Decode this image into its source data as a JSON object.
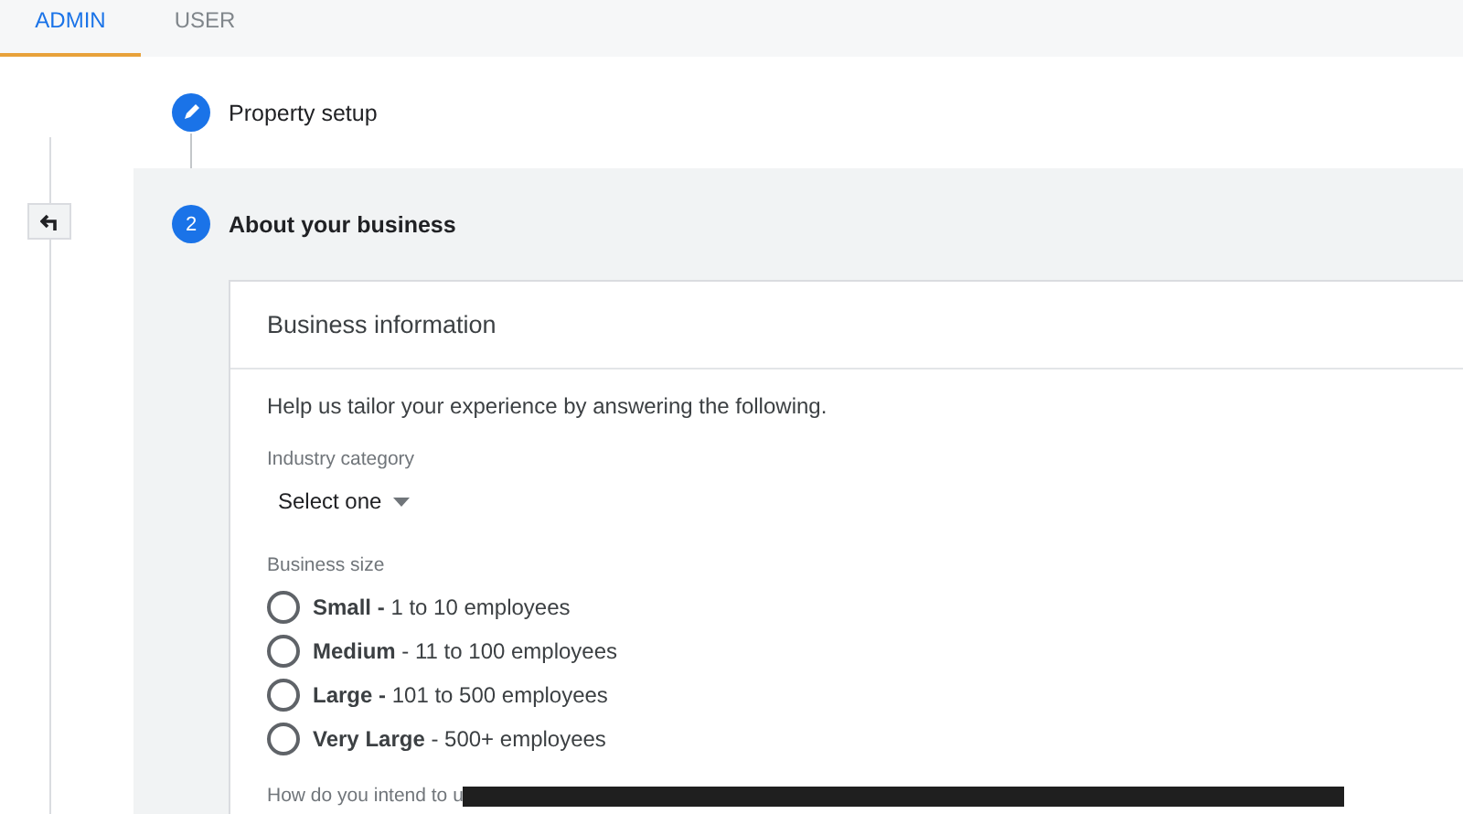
{
  "tabs": [
    {
      "label": "ADMIN",
      "selected": true
    },
    {
      "label": "USER",
      "selected": false
    }
  ],
  "steps": [
    {
      "kind": "done",
      "label": "Property setup",
      "active": false
    },
    {
      "kind": "number",
      "number": "2",
      "label": "About your business",
      "active": true
    }
  ],
  "card": {
    "title": "Business information",
    "intro": "Help us tailor your experience by answering the following.",
    "industry": {
      "label": "Industry category",
      "value": "Select one"
    },
    "size": {
      "label": "Business size",
      "options": [
        {
          "text": "**Small -** 1 to 10 employees",
          "selected": false
        },
        {
          "text": "**Medium** - 11 to 100 employees",
          "selected": false
        },
        {
          "text": "**Large -** 101 to 500 employees",
          "selected": false
        },
        {
          "text": "**Very Large** - 500+ employees",
          "selected": false
        }
      ]
    },
    "next_question": "How do you intend to u"
  }
}
